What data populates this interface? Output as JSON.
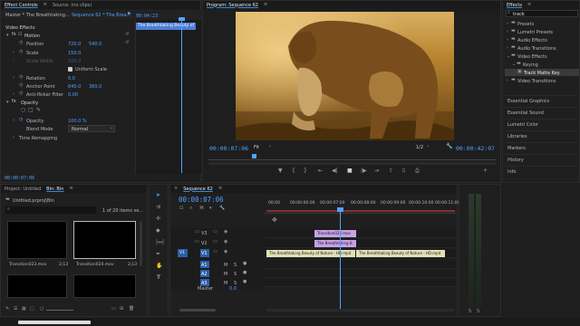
{
  "effect_controls": {
    "tabs": [
      "Effect Controls",
      "Source: (no clips)"
    ],
    "master_label": "Master * The Breathtaking...",
    "sequence_label": "Sequence 62 * The Brea...",
    "timecode": "00:04:23",
    "clip_label": "The Breathtaking Beauty of",
    "section": "Video Effects",
    "motion": "Motion",
    "params": [
      {
        "label": "Position",
        "v1": "720.0",
        "v2": "540.0"
      },
      {
        "label": "Scale",
        "v1": "150.0",
        "v2": ""
      },
      {
        "label": "Scale Width",
        "v1": "100.0",
        "v2": ""
      },
      {
        "label": "Uniform Scale",
        "v1": "",
        "v2": ""
      },
      {
        "label": "Rotation",
        "v1": "0.0",
        "v2": ""
      },
      {
        "label": "Anchor Point",
        "v1": "640.0",
        "v2": "360.0"
      },
      {
        "label": "Anti-flicker Filter",
        "v1": "0.00",
        "v2": ""
      }
    ],
    "opacity_section": "Opacity",
    "opacity_label": "Opacity",
    "opacity_value": "100.0 %",
    "blend_label": "Blend Mode",
    "blend_value": "Normal",
    "time_remap": "Time Remapping",
    "bottom_timecode": "00:00:07:06"
  },
  "program": {
    "title": "Program: Sequence 62",
    "timecode": "00:00:07:06",
    "fit": "Fit",
    "fraction": "1/2",
    "duration": "00:00:42:07"
  },
  "effects": {
    "title": "Effects",
    "search_value": "track",
    "tree": [
      "Presets",
      "Lumetri Presets",
      "Audio Effects",
      "Audio Transitions",
      "Video Effects",
      "Keying",
      "Track Matte Key",
      "Video Transitions"
    ],
    "panels": [
      "Essential Graphics",
      "Essential Sound",
      "Lumetri Color",
      "Libraries",
      "Markers",
      "History",
      "Info"
    ]
  },
  "project": {
    "tabs": [
      "Project: Untitled",
      "Bin: Bin"
    ],
    "file": "Untitled.prproj\\Bin",
    "count": "1 of 20 items se...",
    "items": [
      {
        "name": "Transition023.mov",
        "dur": "2;13"
      },
      {
        "name": "Transition024.mov",
        "dur": "2;13"
      }
    ]
  },
  "timeline": {
    "title": "Sequence 62",
    "timecode": "00:00:07:06",
    "ruler": [
      "00:00",
      "00:00:06:00",
      "00:00:07:00",
      "00:00:08:00",
      "00:00:09:00",
      "00:00:10:00",
      "00:00:11:00"
    ],
    "tracks": [
      "V3",
      "V2",
      "V1",
      "A1",
      "A2",
      "A3"
    ],
    "master_label": "Master",
    "master_value": "0.0",
    "clips": {
      "v3": "Transition024.mov",
      "v2": "The Breathtaking B",
      "v1a": "The Breathtaking Beauty of Nature - HD.mp4",
      "v1b": "The Breathtaking Beauty of Nature - HD.mp4"
    }
  }
}
